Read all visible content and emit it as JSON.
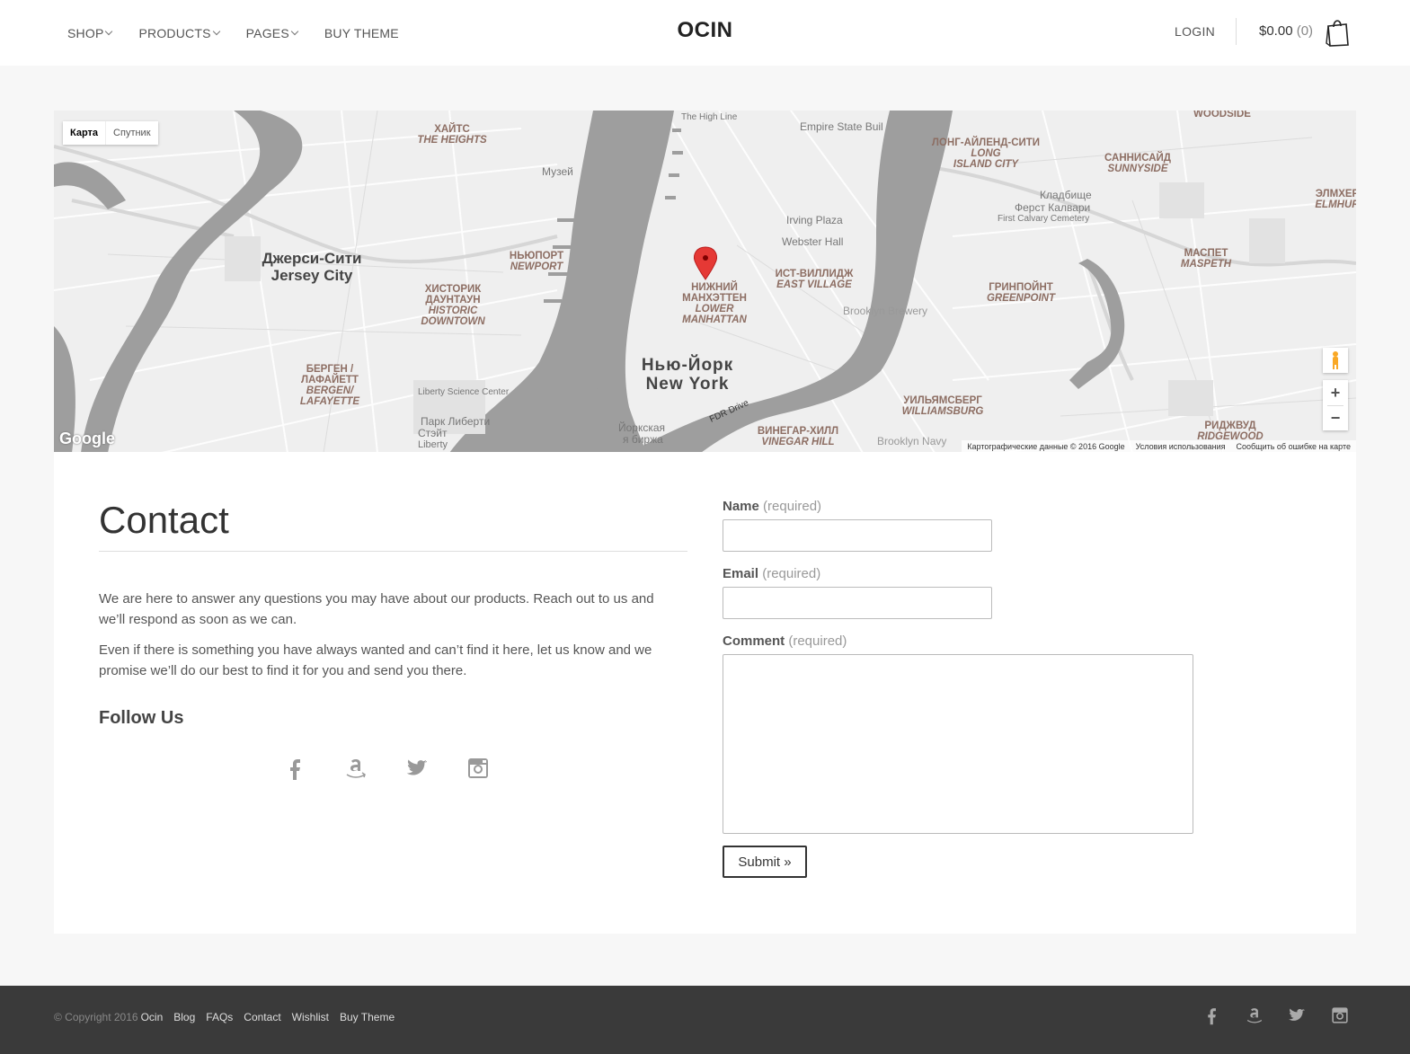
{
  "header": {
    "nav": [
      {
        "label": "SHOP",
        "has_dropdown": true
      },
      {
        "label": "PRODUCTS",
        "has_dropdown": true
      },
      {
        "label": "PAGES",
        "has_dropdown": true
      },
      {
        "label": "BUY THEME",
        "has_dropdown": false
      }
    ],
    "brand": "OCIN",
    "login": "LOGIN",
    "cart_total": "$0.00",
    "cart_count": "(0)",
    "cart_icon": "shopping-bag-icon"
  },
  "map": {
    "type_buttons": [
      "Карта",
      "Спутник"
    ],
    "zoom_in": "+",
    "zoom_out": "−",
    "logo": "Google",
    "footer_links": [
      "Картографические данные © 2016 Google",
      "Условия использования",
      "Сообщить об ошибке на карте"
    ],
    "labels": {
      "jersey_ru": "Джерси-Сити",
      "jersey_en": "Jersey City",
      "ny_ru": "Нью-Йорк",
      "ny_en": "New York",
      "lower_ru_1": "НИЖНИЙ",
      "lower_ru_2": "МАНХЭТТЕН",
      "lower_en_1": "LOWER",
      "lower_en_2": "MANHATTAN",
      "heights_ru": "ХАЙТС",
      "heights_en": "THE HEIGHTS",
      "newport_ru": "НЬЮПОРТ",
      "newport_en": "NEWPORT",
      "hd_ru_1": "ХИСТОРИК",
      "hd_ru_2": "ДАУНТАУН",
      "hd_en_1": "HISTORIC",
      "hd_en_2": "DOWNTOWN",
      "bergen_ru_1": "БЕРГЕН /",
      "bergen_ru_2": "ЛАФАЙЕТТ",
      "bergen_en_1": "BERGEN/",
      "bergen_en_2": "LAFAYETTE",
      "ev_ru": "ИСТ-ВИЛЛИДЖ",
      "ev_en": "EAST VILLAGE",
      "lic_ru": "ЛОНГ-АЙЛЕНД-СИТИ",
      "lic_en_1": "LONG",
      "lic_en_2": "ISLAND CITY",
      "sunny_ru": "САННИСАЙД",
      "sunny_en": "SUNNYSIDE",
      "green_ru": "ГРИНПОЙНТ",
      "green_en": "GREENPOINT",
      "maspeth_ru": "МАСПЕТ",
      "maspeth_en": "MASPETH",
      "wb_ru": "УИЛЬЯМСБЕРГ",
      "wb_en": "WILLIAMSBURG",
      "vh_ru": "ВИНЕГАР-ХИЛЛ",
      "vh_en": "VINEGAR HILL",
      "ridge_ru": "РИДЖВУД",
      "ridge_en": "RIDGEWOOD",
      "elmh_ru": "ЭЛМХЕР",
      "elmh_en": "ELMHUR",
      "woodside": "WOODSIDE",
      "esb": "Empire State Buil",
      "irving": "Irving Plaza",
      "webster": "Webster Hall",
      "high_line": "The High Line",
      "calvary_ru": "Кладбище",
      "calvary_ru2": "Ферст Калвари",
      "calvary_en": "First Calvary Cemetery",
      "museum": "Музей",
      "liberty_park_1": "Парк Либерти",
      "liberty_park_2": "Стэйт",
      "liberty_park_3": "Liberty",
      "exchange_1": "Йоркская",
      "exchange_2": "я биржа",
      "fdr": "FDR Drive",
      "brewery": "Brooklyn Brewery",
      "brooklyn_navy": "Brooklyn Navy",
      "liberty_sc": "Liberty Science Center"
    }
  },
  "contact": {
    "title": "Contact",
    "paragraph1": "We are here to answer any questions you may have about our products. Reach out to us and we’ll respond as soon as we can.",
    "paragraph2": "Even if there is something you have always wanted and can’t find it here, let us know and we promise we’ll do our best to find it for you and send you there.",
    "follow_title": "Follow Us",
    "social": [
      "facebook-icon",
      "amazon-icon",
      "twitter-icon",
      "instagram-icon"
    ]
  },
  "form": {
    "name_label": "Name",
    "email_label": "Email",
    "comment_label": "Comment",
    "required_text": "(required)",
    "name_value": "",
    "email_value": "",
    "comment_value": "",
    "submit_label": "Submit »"
  },
  "footer": {
    "copyright": "© Copyright 2016",
    "brand": "Ocin",
    "links": [
      "Blog",
      "FAQs",
      "Contact",
      "Wishlist",
      "Buy Theme"
    ]
  },
  "colors": {
    "background": "#f7f7f7",
    "footer": "#3a3a3a",
    "water": "#9e9e9e",
    "pin": "#e53935"
  }
}
